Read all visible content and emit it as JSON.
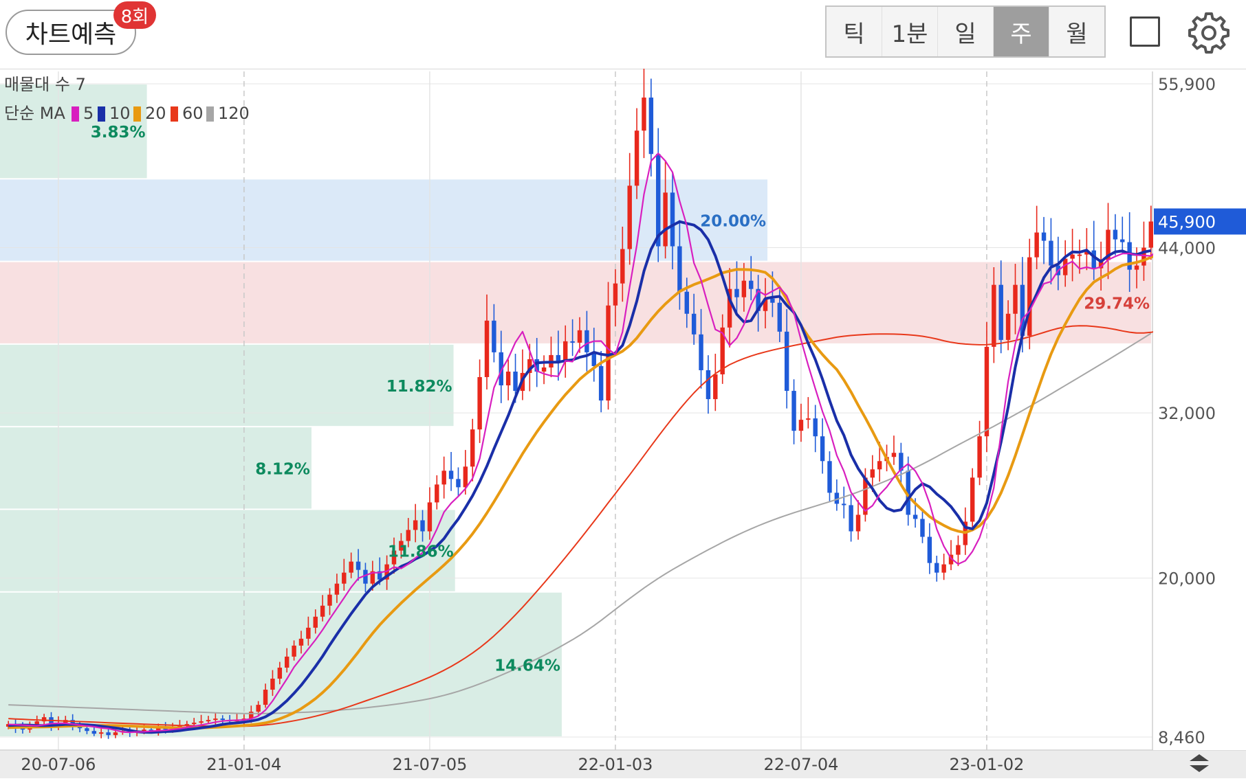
{
  "header": {
    "predict_label": "차트예측",
    "predict_count": "8회",
    "periods": [
      {
        "label": "틱",
        "active": false
      },
      {
        "label": "1분",
        "active": false
      },
      {
        "label": "일",
        "active": false
      },
      {
        "label": "주",
        "active": true
      },
      {
        "label": "월",
        "active": false
      }
    ],
    "fullscreen_icon": "square-icon",
    "settings_icon": "gear-icon"
  },
  "colors": {
    "up": "#e8281c",
    "down": "#1f5bd8",
    "ma5": "#d81fbf",
    "ma10": "#1a2fa8",
    "ma20": "#e89a12",
    "ma60": "#e8381a",
    "ma120": "#a6a6a6",
    "vp_green": "#d9ede5",
    "vp_blue": "#dbe9f8",
    "vp_red": "#f8e0e1",
    "pct_green": "#0d8a5e",
    "pct_blue": "#2a6fc4",
    "pct_red": "#d6403a",
    "current_price_bg": "#1f5bd8"
  },
  "chart_data": {
    "type": "candlestick",
    "interval": "weekly",
    "legend": {
      "volume_profile": "매물대 수 7",
      "ma_prefix": "단순 MA",
      "ma_periods": [
        "5",
        "10",
        "20",
        "60",
        "120"
      ]
    },
    "y_ticks": [
      "55,900",
      "44,000",
      "32,000",
      "20,000",
      "8,460"
    ],
    "y_tick_values": [
      55900,
      44000,
      32000,
      20000,
      8460
    ],
    "current_price": 45900,
    "current_price_label": "45,900",
    "x_ticks": [
      "20-07-06",
      "21-01-04",
      "21-07-05",
      "22-01-03",
      "22-07-04",
      "23-01-02"
    ],
    "x_tick_index": [
      7,
      33,
      59,
      85,
      111,
      137
    ],
    "volume_profile": [
      {
        "from": 49000,
        "to": 55900,
        "pct": "3.83%",
        "strength": 0.1276,
        "color": "green"
      },
      {
        "from": 43000,
        "to": 49000,
        "pct": "20.00%",
        "strength": 0.6667,
        "color": "blue"
      },
      {
        "from": 37000,
        "to": 43000,
        "pct": "29.74%",
        "strength": 1.0,
        "color": "red"
      },
      {
        "from": 31000,
        "to": 37000,
        "pct": "11.82%",
        "strength": 0.394,
        "color": "green"
      },
      {
        "from": 25000,
        "to": 31000,
        "pct": "8.12%",
        "strength": 0.2706,
        "color": "green"
      },
      {
        "from": 19000,
        "to": 25000,
        "pct": "11.86%",
        "strength": 0.3953,
        "color": "green"
      },
      {
        "from": 8460,
        "to": 19000,
        "pct": "14.64%",
        "strength": 0.488,
        "color": "green"
      }
    ],
    "close": [
      9400,
      9100,
      9000,
      9300,
      9600,
      9900,
      9200,
      9500,
      9700,
      9300,
      9100,
      8900,
      8700,
      8800,
      8600,
      8800,
      8900,
      8800,
      8900,
      9000,
      8900,
      9100,
      9000,
      9200,
      9300,
      9400,
      9500,
      9600,
      9700,
      9800,
      9700,
      9600,
      9700,
      9800,
      10300,
      10800,
      11900,
      12700,
      13500,
      14300,
      15100,
      15600,
      16400,
      17200,
      18000,
      18800,
      19600,
      20400,
      21200,
      20600,
      19600,
      20500,
      19900,
      21000,
      22000,
      22700,
      23500,
      24200,
      23400,
      25500,
      26800,
      27800,
      27200,
      26600,
      28100,
      30800,
      34600,
      38700,
      36400,
      34000,
      35000,
      33600,
      34900,
      35900,
      35000,
      35300,
      36200,
      35700,
      37200,
      37100,
      38000,
      36400,
      35400,
      32900,
      39800,
      41400,
      43900,
      48500,
      52500,
      54900,
      50800,
      44100,
      48000,
      44100,
      40800,
      39200,
      37700,
      35100,
      33000,
      34800,
      38200,
      41000,
      40400,
      41600,
      41000,
      39400,
      40300,
      40000,
      37900,
      33600,
      30700,
      31500,
      31600,
      30300,
      28500,
      26200,
      25400,
      25300,
      23400,
      24600,
      27300,
      27900,
      28500,
      28800,
      29100,
      27800,
      24600,
      24300,
      23000,
      21100,
      20400,
      21000,
      21700,
      22400,
      24100,
      27300,
      30300,
      36800,
      41300,
      37300,
      39200,
      41300,
      37600,
      43300,
      45100,
      44500,
      42700,
      42000,
      43200,
      43500,
      43500,
      43800,
      42500,
      43100,
      45300,
      44600,
      44400,
      42400,
      42700,
      44000,
      45900
    ],
    "ma5": [
      9380,
      9360,
      9330,
      9300,
      9280,
      9350,
      9440,
      9460,
      9460,
      9400,
      9330,
      9270,
      9210,
      9120,
      9080,
      8950,
      8830,
      8800,
      8830,
      8840,
      8890,
      8920,
      8950,
      9010,
      9070,
      9160,
      9250,
      9340,
      9440,
      9540,
      9620,
      9660,
      9680,
      9700,
      9780,
      9990,
      10420,
      11080,
      11880,
      12680,
      13540,
      14200,
      14860,
      15520,
      16240,
      17040,
      17800,
      18560,
      19340,
      19990,
      20200,
      20390,
      20400,
      20500,
      20800,
      20700,
      21020,
      21460,
      21850,
      22490,
      23560,
      24790,
      25440,
      25940,
      26500,
      27240,
      28680,
      31300,
      33830,
      35070,
      35960,
      37120,
      37900,
      36520,
      35050,
      34840,
      34700,
      34660,
      35780,
      35720,
      36660,
      37040,
      37210,
      37220,
      36640,
      36250,
      37880,
      41160,
      44180,
      47880,
      50300,
      50840,
      50300,
      49480,
      47380,
      45600,
      42880,
      41640,
      39800,
      38060,
      37800,
      36900,
      37440,
      38420,
      39840,
      40860,
      40560,
      40840,
      41120,
      40500,
      39260,
      37300,
      35460,
      33760,
      32100,
      30720,
      28920,
      27770,
      26240,
      25520,
      24880,
      25260,
      26070,
      26620,
      27320,
      27900,
      28300,
      27780,
      26860,
      25420,
      23560,
      22320,
      21440,
      21020,
      21260,
      21940,
      22940,
      24520,
      26560,
      30500,
      34280,
      37020,
      38820,
      39400,
      40420,
      41380,
      41540,
      42340,
      42740,
      43000,
      42460,
      42580,
      42460,
      42610,
      43120,
      43360,
      43570,
      43580,
      43460,
      43430,
      43400,
      43840
    ],
    "ma10": [
      9300,
      9320,
      9330,
      9320,
      9300,
      9300,
      9310,
      9340,
      9380,
      9380,
      9370,
      9350,
      9310,
      9250,
      9180,
      9120,
      9040,
      8940,
      8850,
      8810,
      8800,
      8830,
      8860,
      8880,
      8930,
      9000,
      9060,
      9130,
      9200,
      9280,
      9380,
      9450,
      9490,
      9540,
      9620,
      9730,
      9930,
      10230,
      10640,
      11100,
      11640,
      12220,
      12890,
      13590,
      14320,
      15140,
      15920,
      16670,
      17420,
      18120,
      18800,
      19360,
      19780,
      20150,
      20500,
      20850,
      21070,
      21390,
      21630,
      21970,
      22330,
      22870,
      23620,
      24300,
      25110,
      25980,
      26990,
      28130,
      29400,
      30610,
      31800,
      33140,
      34430,
      35170,
      35630,
      35670,
      35680,
      35680,
      35790,
      35850,
      36040,
      36160,
      36400,
      36260,
      36190,
      36350,
      36900,
      38350,
      40120,
      42290,
      43890,
      44860,
      45320,
      45620,
      45890,
      45760,
      45640,
      45280,
      44580,
      43410,
      41900,
      40240,
      39160,
      38600,
      38700,
      39540,
      40300,
      40400,
      40460,
      39810,
      39290,
      38370,
      37060,
      35870,
      34450,
      32900,
      31430,
      30380,
      28950,
      27960,
      27190,
      26500,
      25650,
      25080,
      24870,
      24960,
      25750,
      26440,
      26860,
      26630,
      26110,
      25700,
      25190,
      24500,
      23690,
      23580,
      24180,
      25460,
      27590,
      29870,
      32410,
      35330,
      37670,
      39540,
      40630,
      41820,
      42580,
      42810,
      43330,
      43690,
      43670,
      43820,
      43350,
      42990,
      43410,
      43700,
      43760,
      43560,
      43500,
      43680,
      43790
    ],
    "ma20": [
      9150,
      9160,
      9170,
      9180,
      9190,
      9200,
      9210,
      9230,
      9250,
      9270,
      9280,
      9290,
      9300,
      9300,
      9300,
      9290,
      9280,
      9260,
      9240,
      9220,
      9200,
      9180,
      9160,
      9140,
      9120,
      9100,
      9110,
      9130,
      9150,
      9170,
      9200,
      9230,
      9260,
      9300,
      9350,
      9410,
      9490,
      9610,
      9780,
      9990,
      10230,
      10520,
      10870,
      11250,
      11690,
      12180,
      12740,
      13340,
      13980,
      14640,
      15330,
      15990,
      16600,
      17150,
      17680,
      18190,
      18670,
      19140,
      19590,
      20040,
      20480,
      20950,
      21440,
      21990,
      22570,
      23220,
      23940,
      24720,
      25550,
      26410,
      27290,
      28160,
      29030,
      29840,
      30620,
      31340,
      32030,
      32700,
      33320,
      33880,
      34440,
      34880,
      35270,
      35640,
      35940,
      36210,
      36480,
      36890,
      37440,
      38110,
      38780,
      39380,
      39910,
      40380,
      40820,
      41080,
      41320,
      41510,
      41720,
      41930,
      42170,
      42300,
      42420,
      42410,
      42390,
      42320,
      42200,
      41770,
      41100,
      40250,
      39280,
      38350,
      37560,
      36860,
      36240,
      35670,
      35150,
      34390,
      33520,
      32560,
      31640,
      30670,
      29640,
      28670,
      27710,
      26790,
      25960,
      25420,
      24930,
      24470,
      24120,
      23830,
      23570,
      23410,
      23310,
      23500,
      23800,
      24350,
      25150,
      26190,
      27450,
      28890,
      30420,
      31970,
      33430,
      34910,
      36270,
      37450,
      38450,
      39390,
      40260,
      40950,
      41500,
      41820,
      42100,
      42450,
      42720,
      42830,
      42930,
      43090,
      43300,
      43540
    ],
    "ma60": [
      9800,
      9770,
      9750,
      9720,
      9700,
      9680,
      9660,
      9640,
      9620,
      9600,
      9580,
      9560,
      9540,
      9520,
      9500,
      9480,
      9460,
      9440,
      9420,
      9400,
      9380,
      9360,
      9340,
      9320,
      9300,
      9290,
      9280,
      9270,
      9260,
      9250,
      9245,
      9240,
      9240,
      9245,
      9260,
      9290,
      9340,
      9400,
      9470,
      9550,
      9640,
      9740,
      9850,
      9970,
      10100,
      10240,
      10390,
      10550,
      10720,
      10900,
      11080,
      11260,
      11440,
      11620,
      11800,
      11990,
      12180,
      12380,
      12590,
      12810,
      13050,
      13310,
      13590,
      13890,
      14210,
      14560,
      14940,
      15360,
      15810,
      16290,
      16800,
      17330,
      17880,
      18450,
      19040,
      19640,
      20250,
      20870,
      21500,
      22140,
      22790,
      23450,
      24120,
      24790,
      25470,
      26140,
      26820,
      27500,
      28200,
      28900,
      29600,
      30290,
      30970,
      31630,
      32270,
      32880,
      33450,
      33970,
      34440,
      34850,
      35200,
      35500,
      35740,
      35950,
      36130,
      36290,
      36430,
      36560,
      36680,
      36790,
      36900,
      37000,
      37100,
      37200,
      37300,
      37400,
      37500,
      37570,
      37620,
      37660,
      37690,
      37720,
      37730,
      37730,
      37720,
      37700,
      37670,
      37630,
      37570,
      37480,
      37370,
      37240,
      37130,
      37050,
      37000,
      36970,
      36950,
      36960,
      37000,
      37060,
      37150,
      37260,
      37390,
      37530,
      37680,
      37840,
      38000,
      38140,
      38240,
      38300,
      38330,
      38320,
      38280,
      38220,
      38150,
      38060,
      37950,
      37860,
      37800,
      37800,
      37850,
      37950
    ],
    "ma120": [
      10800,
      10780,
      10760,
      10740,
      10720,
      10700,
      10680,
      10660,
      10640,
      10620,
      10600,
      10580,
      10560,
      10540,
      10520,
      10500,
      10480,
      10460,
      10440,
      10420,
      10400,
      10380,
      10360,
      10340,
      10320,
      10300,
      10280,
      10260,
      10240,
      10220,
      10200,
      10190,
      10180,
      10170,
      10170,
      10170,
      10170,
      10180,
      10190,
      10210,
      10230,
      10250,
      10270,
      10300,
      10330,
      10360,
      10400,
      10440,
      10480,
      10530,
      10580,
      10640,
      10700,
      10760,
      10830,
      10900,
      10980,
      11060,
      11150,
      11250,
      11360,
      11490,
      11630,
      11780,
      11950,
      12130,
      12320,
      12520,
      12730,
      12950,
      13170,
      13400,
      13640,
      13880,
      14130,
      14390,
      14660,
      14940,
      15230,
      15530,
      15850,
      16190,
      16550,
      16930,
      17330,
      17730,
      18130,
      18520,
      18900,
      19280,
      19640,
      19980,
      20310,
      20620,
      20920,
      21210,
      21500,
      21780,
      22060,
      22330,
      22600,
      22860,
      23110,
      23350,
      23580,
      23800,
      24010,
      24210,
      24400,
      24580,
      24750,
      24910,
      25070,
      25230,
      25390,
      25550,
      25720,
      25890,
      26070,
      26260,
      26460,
      26660,
      26870,
      27080,
      27300,
      27530,
      27770,
      28020,
      28280,
      28550,
      28830,
      29110,
      29390,
      29670,
      29950,
      30220,
      30490,
      30760,
      31030,
      31310,
      31590,
      31880,
      32170,
      32470,
      32770,
      33070,
      33370,
      33680,
      33990,
      34300,
      34610,
      34920,
      35230,
      35540,
      35850,
      36170,
      36490,
      36810,
      37130,
      37450,
      37770
    ]
  }
}
